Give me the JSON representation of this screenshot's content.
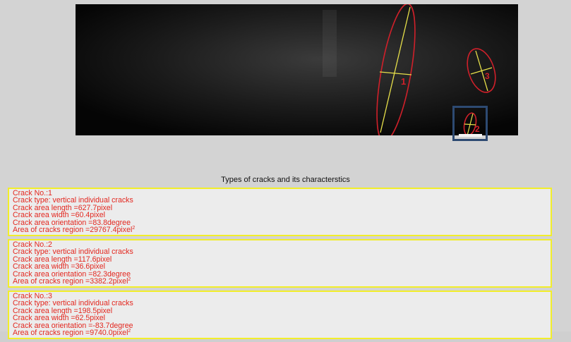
{
  "image": {
    "crack_labels": [
      "1",
      "2",
      "3"
    ]
  },
  "results": {
    "title": "Types of cracks and its characterstics",
    "cracks": [
      {
        "number": "Crack No.:1",
        "type": "Crack type: vertical individual cracks",
        "length": "Crack area length =627.7pixel",
        "width": "Crack area width =60.4pixel",
        "orientation": "Crack area orientation =83.8degree",
        "region": "Area of cracks region =29767.4pixel",
        "region_exp": "2"
      },
      {
        "number": "Crack No.:2",
        "type": "Crack type: vertical individual cracks",
        "length": "Crack area length =117.6pixel",
        "width": "Crack area width =36.6pixel",
        "orientation": "Crack area orientation =82.3degree",
        "region": "Area of cracks region =3382.2pixel",
        "region_exp": "2"
      },
      {
        "number": "Crack No.:3",
        "type": "Crack type: vertical individual cracks",
        "length": "Crack area length =198.5pixel",
        "width": "Crack area width =62.5pixel",
        "orientation": "Crack area orientation =-83.7degree",
        "region": "Area of cracks region =9740.0pixel",
        "region_exp": "2"
      }
    ]
  },
  "colors": {
    "image_background": "#111111",
    "ellipse": "#d0202a",
    "axis": "#e7e04a",
    "text": "#e3271f",
    "card_border": "#f2ee2a",
    "selection_box": "#2d4a72"
  }
}
